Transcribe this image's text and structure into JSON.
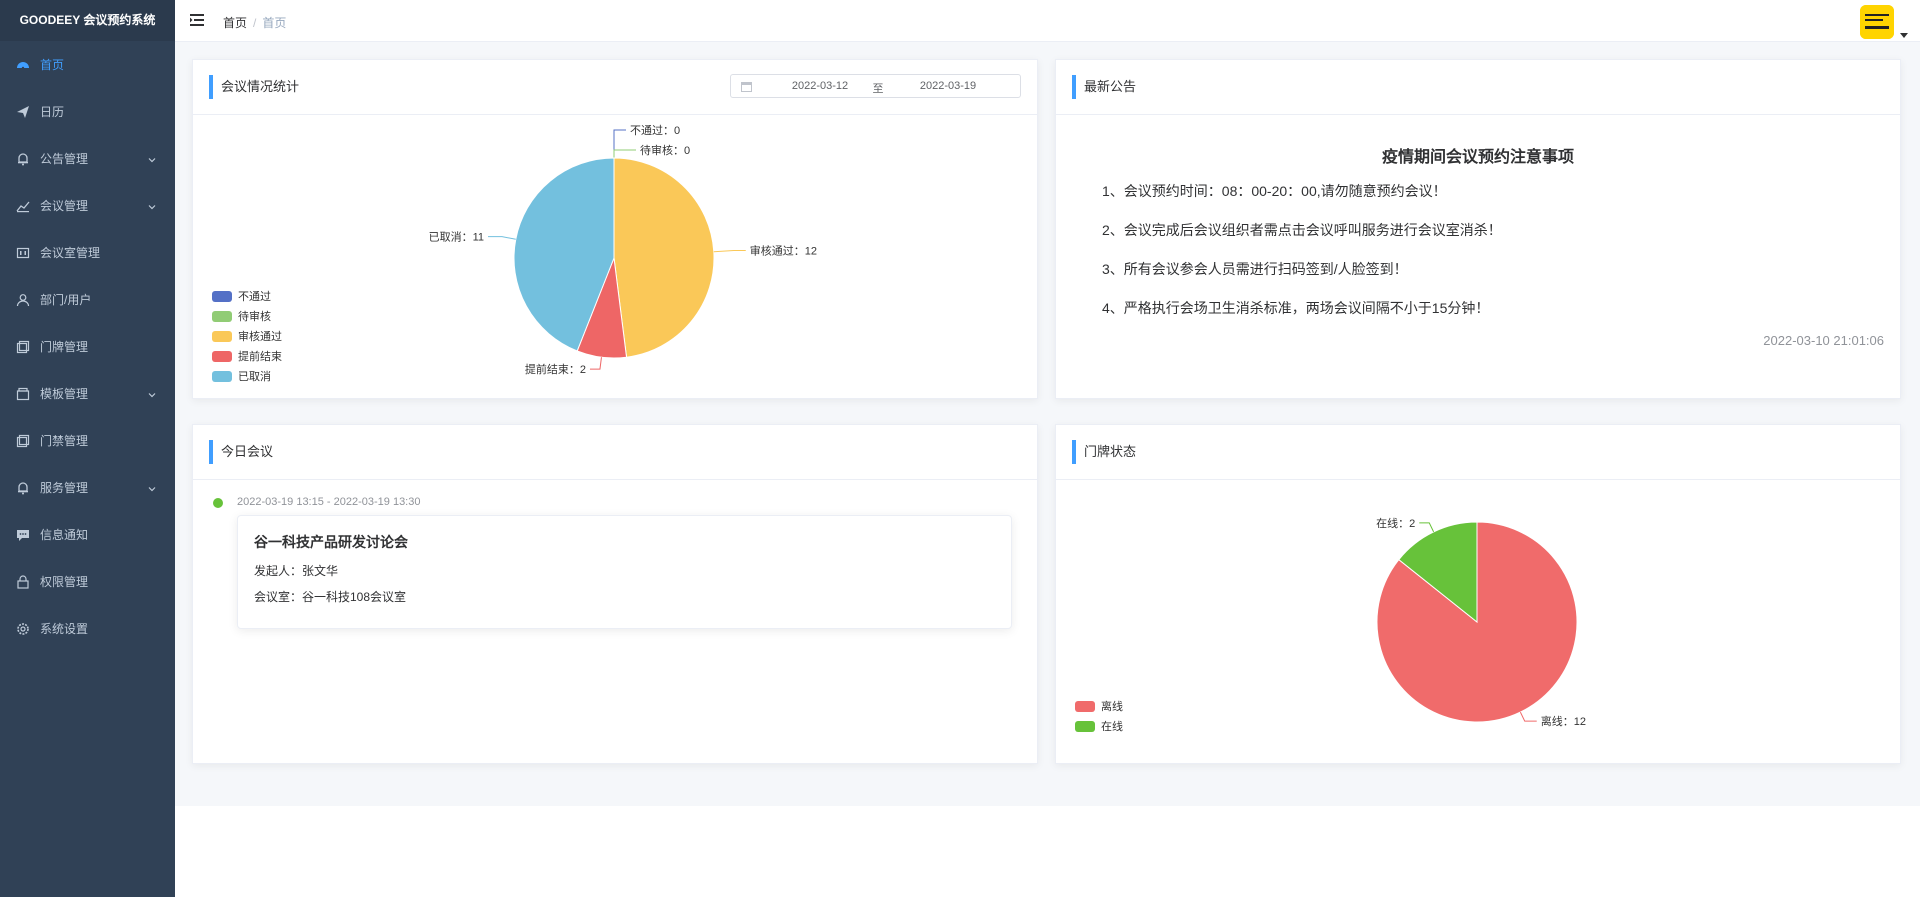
{
  "app": {
    "brand": "GOODEEY 会议预约系统"
  },
  "sidebar": {
    "items": [
      {
        "label": "首页",
        "icon": "dashboard-icon",
        "active": true,
        "expandable": false
      },
      {
        "label": "日历",
        "icon": "send-icon",
        "active": false,
        "expandable": false
      },
      {
        "label": "公告管理",
        "icon": "bell-icon",
        "active": false,
        "expandable": true
      },
      {
        "label": "会议管理",
        "icon": "chart-icon",
        "active": false,
        "expandable": true
      },
      {
        "label": "会议室管理",
        "icon": "room-icon",
        "active": false,
        "expandable": false
      },
      {
        "label": "部门/用户",
        "icon": "user-icon",
        "active": false,
        "expandable": false
      },
      {
        "label": "门牌管理",
        "icon": "copy-icon",
        "active": false,
        "expandable": false
      },
      {
        "label": "模板管理",
        "icon": "box-icon",
        "active": false,
        "expandable": true
      },
      {
        "label": "门禁管理",
        "icon": "copy-icon",
        "active": false,
        "expandable": false
      },
      {
        "label": "服务管理",
        "icon": "bell-icon",
        "active": false,
        "expandable": true
      },
      {
        "label": "信息通知",
        "icon": "message-icon",
        "active": false,
        "expandable": false
      },
      {
        "label": "权限管理",
        "icon": "lock-icon",
        "active": false,
        "expandable": false
      },
      {
        "label": "系统设置",
        "icon": "gear-icon",
        "active": false,
        "expandable": false
      }
    ]
  },
  "header": {
    "breadcrumb": [
      "首页",
      "首页"
    ]
  },
  "colors": {
    "accent": "#409eff",
    "sidebar_bg": "#304156",
    "sidebar_text": "#bfcbd9"
  },
  "stats_card": {
    "title": "会议情况统计",
    "date_start": "2022-03-12",
    "date_sep": "至",
    "date_end": "2022-03-19"
  },
  "notice_card": {
    "title": "最新公告",
    "notice_title": "疫情期间会议预约注意事项",
    "lines": [
      "1、会议预约时间：08：00-20：00,请勿随意预约会议！",
      "2、会议完成后会议组织者需点击会议呼叫服务进行会议室消杀！",
      "3、所有会议参会人员需进行扫码签到/人脸签到！",
      "4、严格执行会场卫生消杀标准，两场会议间隔不小于15分钟！"
    ],
    "date": "2022-03-10 21:01:06"
  },
  "today_card": {
    "title": "今日会议",
    "time": "2022-03-19 13:15 - 2022-03-19 13:30",
    "meeting_title": "谷一科技产品研发讨论会",
    "initiator": "发起人：张文华",
    "room": "会议室：谷一科技108会议室"
  },
  "doorplate_card": {
    "title": "门牌状态"
  },
  "chart_data": [
    {
      "type": "pie",
      "title": "",
      "legend_position": "bottom-left",
      "slices": [
        {
          "name": "不通过",
          "value": 0,
          "color": "#5470c6",
          "label": "不通过：0"
        },
        {
          "name": "待审核",
          "value": 0,
          "color": "#91cc75",
          "label": "待审核：0"
        },
        {
          "name": "审核通过",
          "value": 12,
          "color": "#fac858",
          "label": "审核通过：12"
        },
        {
          "name": "提前结束",
          "value": 2,
          "color": "#ee6666",
          "label": "提前结束：2"
        },
        {
          "name": "已取消",
          "value": 11,
          "color": "#73c0de",
          "label": "已取消：11"
        }
      ]
    },
    {
      "type": "pie",
      "title": "",
      "legend_position": "bottom-left",
      "slices": [
        {
          "name": "离线",
          "value": 12,
          "color": "#f06b6b",
          "label": "离线：12"
        },
        {
          "name": "在线",
          "value": 2,
          "color": "#67c23a",
          "label": "在线：2"
        }
      ]
    }
  ]
}
